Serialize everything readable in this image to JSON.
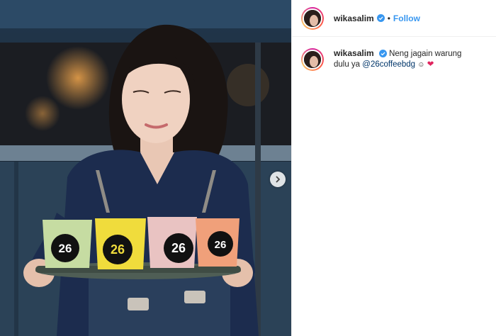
{
  "post": {
    "username": "wikasalim",
    "follow_label": "Follow",
    "separator": "•",
    "caption": {
      "text_before": "Neng jagain warung dulu ya",
      "mention": "@26coffeebdg",
      "emoji_1": "☺",
      "emoji_2": "❤"
    }
  },
  "photo": {
    "cup_logo": "26"
  },
  "icons": {
    "verified": "verified-badge-icon",
    "next": "chevron-right-icon"
  },
  "colors": {
    "accent": "#3897f0",
    "heart": "#e0245e"
  }
}
